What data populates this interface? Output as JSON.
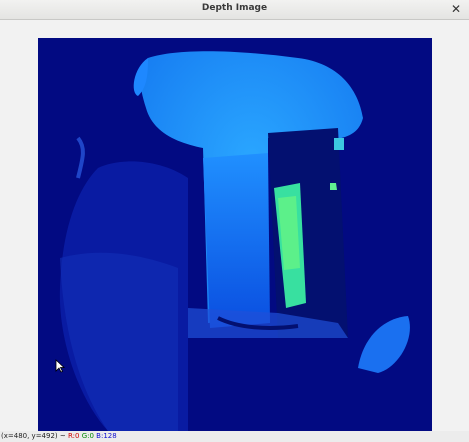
{
  "window": {
    "title": "Depth Image",
    "close_icon": "close-icon"
  },
  "status": {
    "coords": "(x=480, y=492) ~",
    "r": "R:0",
    "g": "G:0",
    "b": "B:128"
  },
  "colors": {
    "background_depth": "#000080",
    "near_region": "#0040e0",
    "mid_region": "#1e90ff",
    "highlight": "#3cf0a0"
  }
}
